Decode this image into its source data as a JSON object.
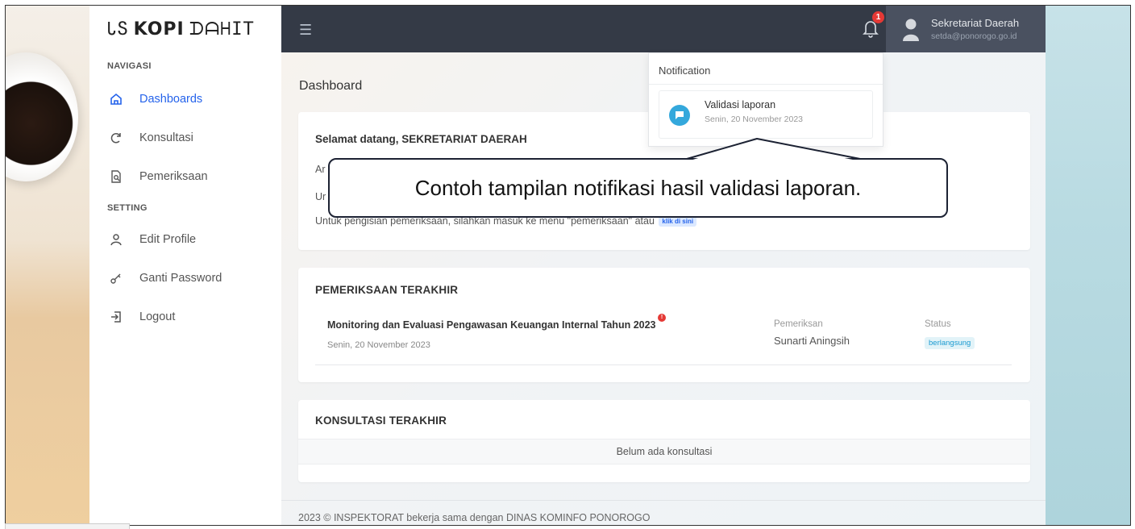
{
  "sidebar": {
    "logo": {
      "part1": "ᏓՏ",
      "part2": "KOPI",
      "part3": "ᗪᗩᕼIT"
    },
    "section_nav": "NAVIGASI",
    "section_setting": "SETTING",
    "items": [
      {
        "label": "Dashboards",
        "icon": "home-icon",
        "active": true
      },
      {
        "label": "Konsultasi",
        "icon": "refresh-icon",
        "active": false
      },
      {
        "label": "Pemeriksaan",
        "icon": "document-search-icon",
        "active": false
      },
      {
        "label": "Edit Profile",
        "icon": "user-icon",
        "active": false
      },
      {
        "label": "Ganti Password",
        "icon": "key-icon",
        "active": false
      },
      {
        "label": "Logout",
        "icon": "logout-icon",
        "active": false
      }
    ]
  },
  "topbar": {
    "notification_count": "1",
    "user_name": "Sekretariat Daerah",
    "user_email": "setda@ponorogo.go.id"
  },
  "main": {
    "page_title": "Dashboard",
    "welcome": {
      "title": "Selamat datang, SEKRETARIAT DAERAH",
      "line1_prefix": "Ar",
      "line2_prefix": "Ur",
      "line3": "Untuk pengisian pemeriksaan, silahkan masuk ke menu \"pemeriksaan\" atau",
      "link_badge": "klik di sini"
    },
    "exam": {
      "title": "PEMERIKSAAN TERAKHIR",
      "name": "Monitoring dan Evaluasi Pengawasan Keuangan Internal Tahun 2023",
      "date": "Senin, 20 November 2023",
      "pemeriksa_label": "Pemeriksan",
      "pemeriksa_value": "Sunarti Aningsih",
      "status_label": "Status",
      "status_value": "berlangsung",
      "alert_mark": "!"
    },
    "konsultasi": {
      "title": "KONSULTASI TERAKHIR",
      "empty_text": "Belum ada konsultasi"
    },
    "footer": "2023 © INSPEKTORAT bekerja sama dengan DINAS KOMINFO PONOROGO"
  },
  "notification": {
    "header": "Notification",
    "item_title": "Validasi laporan",
    "item_date": "Senin, 20 November 2023"
  },
  "callout": {
    "text": "Contoh tampilan notifikasi hasil validasi laporan."
  },
  "colors": {
    "accent": "#2563eb",
    "topbar": "#343a46",
    "badge_red": "#e53935",
    "notif_icon": "#34a8dc"
  }
}
